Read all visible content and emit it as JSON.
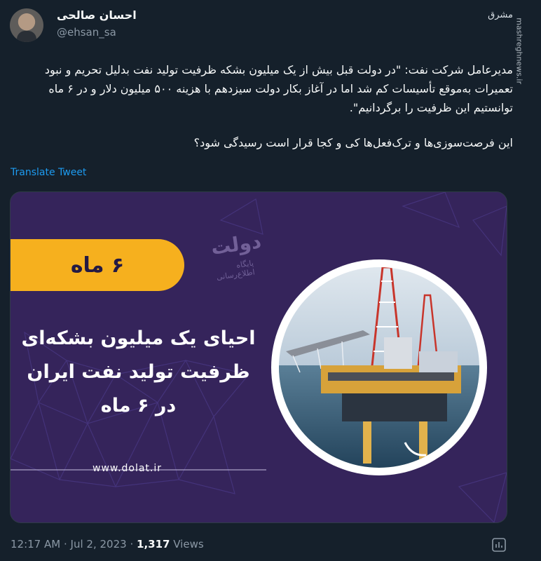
{
  "author": {
    "name": "احسان صالحی",
    "handle": "@ehsan_sa"
  },
  "source": {
    "logo": "مشرق",
    "watermark": "mashreghnews.ir"
  },
  "tweet": {
    "paragraph1": "مدیرعامل شرکت نفت: \"در دولت قبل بیش از یک میلیون بشکه ظرفیت تولید نفت بدلیل تحریم و نبود تعمیرات به‌موقع تأسیسات کم شد اما در آغاز بکار دولت سیزدهم با هزینه ۵۰۰ میلیون دلار و در ۶ ماه توانستیم این ظرفیت را برگردانیم\".",
    "paragraph2": "این فرصت‌سوزی‌ها و ترک‌فعل‌ها کی و کجا قرار است رسیدگی شود؟",
    "translate_label": "Translate Tweet"
  },
  "card": {
    "badge": "۶ ماه",
    "logo_title": "دولت",
    "logo_subtitle": "پایگاه اطلاع‌رسانی",
    "headline_line1": "احیای یک میلیون بشکه‌ای",
    "headline_line2": "ظرفیت تولید نفت ایران",
    "headline_line3": "در ۶ ماه",
    "website": "www.dolat.ir",
    "colors": {
      "background": "#35245b",
      "accent": "#f6b01e"
    }
  },
  "meta": {
    "time": "12:17 AM",
    "separator": "·",
    "date": "Jul 2, 2023",
    "views_count": "1,317",
    "views_label": "Views"
  },
  "icons": {
    "stats": "view-analytics-icon"
  }
}
